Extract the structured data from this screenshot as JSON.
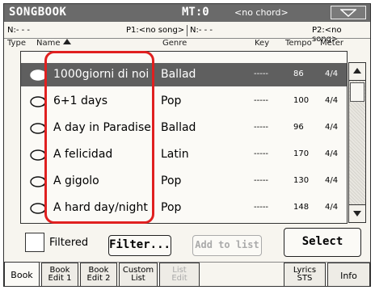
{
  "title": {
    "app": "SONGBOOK",
    "mt": "MT:0",
    "chord": "<no chord>"
  },
  "players": {
    "p1_left": "N:- - -",
    "p1_right": "P1:<no song>",
    "p2_left": "N:- - -",
    "p2_right": "P2:<no song>"
  },
  "columns": {
    "type": "Type",
    "name": "Name",
    "genre": "Genre",
    "key": "Key",
    "tempo": "Tempo",
    "meter": "Meter"
  },
  "rows": [
    {
      "name": "1000giorni di noi",
      "genre": "Ballad",
      "key": "-----",
      "tempo": "86",
      "meter": "4/4",
      "selected": true
    },
    {
      "name": "6+1 days",
      "genre": "Pop",
      "key": "-----",
      "tempo": "100",
      "meter": "4/4",
      "selected": false
    },
    {
      "name": "A day in Paradise",
      "genre": "Ballad",
      "key": "-----",
      "tempo": "96",
      "meter": "4/4",
      "selected": false
    },
    {
      "name": "A felicidad",
      "genre": "Latin",
      "key": "-----",
      "tempo": "170",
      "meter": "4/4",
      "selected": false
    },
    {
      "name": "A gigolo",
      "genre": "Pop",
      "key": "-----",
      "tempo": "130",
      "meter": "4/4",
      "selected": false
    },
    {
      "name": "A hard day/night",
      "genre": "Pop",
      "key": "-----",
      "tempo": "148",
      "meter": "4/4",
      "selected": false
    }
  ],
  "controls": {
    "filtered_label": "Filtered",
    "filter_button": "Filter...",
    "add_to_list_button": "Add to list",
    "select_button": "Select"
  },
  "tabs": [
    {
      "line1": "Book",
      "line2": ""
    },
    {
      "line1": "Book",
      "line2": "Edit 1"
    },
    {
      "line1": "Book",
      "line2": "Edit 2"
    },
    {
      "line1": "Custom",
      "line2": "List"
    },
    {
      "line1": "List",
      "line2": "Edit"
    },
    {
      "line1": "Lyrics",
      "line2": "STS"
    },
    {
      "line1": "Info",
      "line2": ""
    }
  ],
  "colors": {
    "titlebar": "#6a6a6a",
    "selected_row": "#5f5f5f",
    "highlight": "#e02020"
  }
}
